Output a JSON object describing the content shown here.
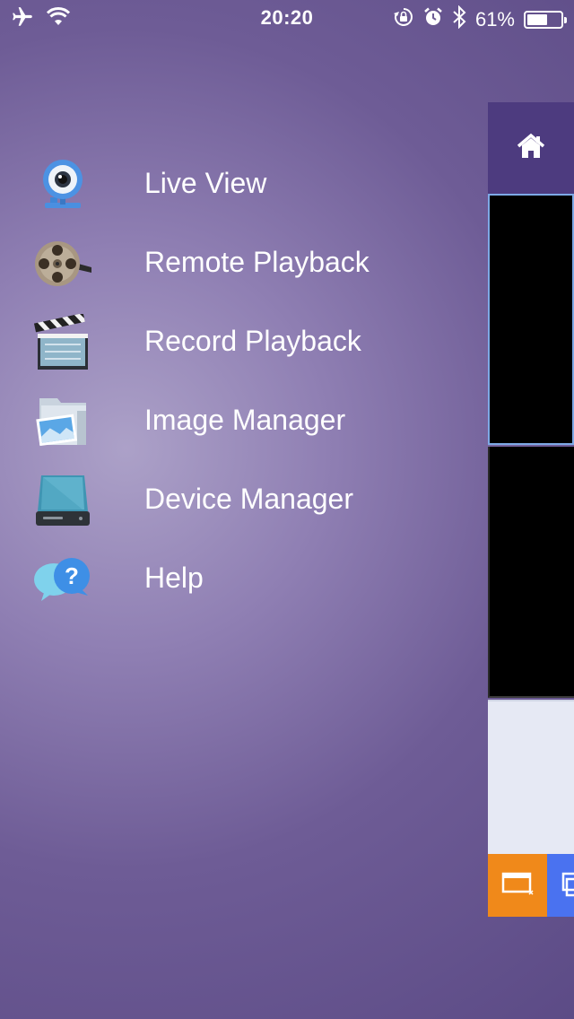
{
  "status_bar": {
    "time": "20:20",
    "battery_text": "61%",
    "battery_level": 0.61,
    "icons": [
      "airplane-icon",
      "wifi-icon",
      "rotation-lock-icon",
      "alarm-icon",
      "bluetooth-icon",
      "battery-icon"
    ]
  },
  "menu": {
    "items": [
      {
        "label": "Live View",
        "icon": "webcam-icon"
      },
      {
        "label": "Remote Playback",
        "icon": "film-reel-icon"
      },
      {
        "label": "Record Playback",
        "icon": "clapperboard-icon"
      },
      {
        "label": "Image Manager",
        "icon": "photo-folder-icon"
      },
      {
        "label": "Device Manager",
        "icon": "hard-drive-icon"
      },
      {
        "label": "Help",
        "icon": "help-bubble-icon"
      }
    ]
  },
  "main_panel": {
    "header_icon": "home-icon",
    "toolbar_icons": [
      "close-window-icon",
      "multi-window-icon"
    ],
    "colors": {
      "header": "#4d3b7f",
      "orange": "#f0891a",
      "blue": "#4a72f0",
      "selected_border": "#7ea9e6"
    }
  }
}
